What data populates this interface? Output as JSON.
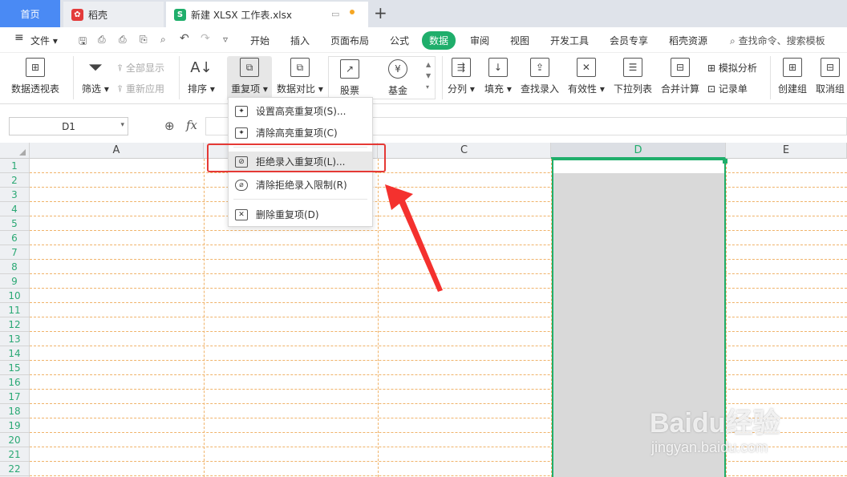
{
  "tabs": {
    "home": "首页",
    "daoke": "稻壳",
    "file": "新建 XLSX 工作表.xlsx",
    "new": "+"
  },
  "menu": {
    "file": "文件",
    "items": [
      "开始",
      "插入",
      "页面布局",
      "公式",
      "数据",
      "审阅",
      "视图",
      "开发工具",
      "会员专享",
      "稻壳资源"
    ],
    "active": "数据",
    "search": "查找命令、搜索模板"
  },
  "ribbon": {
    "pivot": "数据透视表",
    "filter": "筛选",
    "show_all": "全部显示",
    "reapply": "重新应用",
    "sort": "排序",
    "duplicates": "重复项",
    "compare": "数据对比",
    "stock": "股票",
    "fund": "基金",
    "split": "分列",
    "fill": "填充",
    "lookup": "查找录入",
    "validity": "有效性",
    "dropdown_list": "下拉列表",
    "consolidate": "合并计算",
    "whatif": "模拟分析",
    "record": "记录单",
    "group": "创建组",
    "ungroup": "取消组"
  },
  "namebox": "D1",
  "fx": "fx",
  "columns": [
    "A",
    "B",
    "C",
    "D",
    "E"
  ],
  "rows": [
    "1",
    "2",
    "3",
    "4",
    "5",
    "6",
    "7",
    "8",
    "9",
    "10",
    "11",
    "12",
    "13",
    "14",
    "15",
    "16",
    "17",
    "18",
    "19",
    "20",
    "21",
    "22"
  ],
  "dropdown": {
    "items": [
      "设置高亮重复项(S)...",
      "清除高亮重复项(C)",
      "拒绝录入重复项(L)...",
      "清除拒绝录入限制(R)",
      "删除重复项(D)"
    ],
    "highlighted": "拒绝录入重复项(L)..."
  },
  "watermark": {
    "brand": "Baidu经验",
    "url": "jingyan.baidu.com"
  },
  "colors": {
    "accent": "#1fae6b",
    "highlight_box": "#e53935",
    "arrow": "#f4312e",
    "selection": "#d9d9d9"
  }
}
